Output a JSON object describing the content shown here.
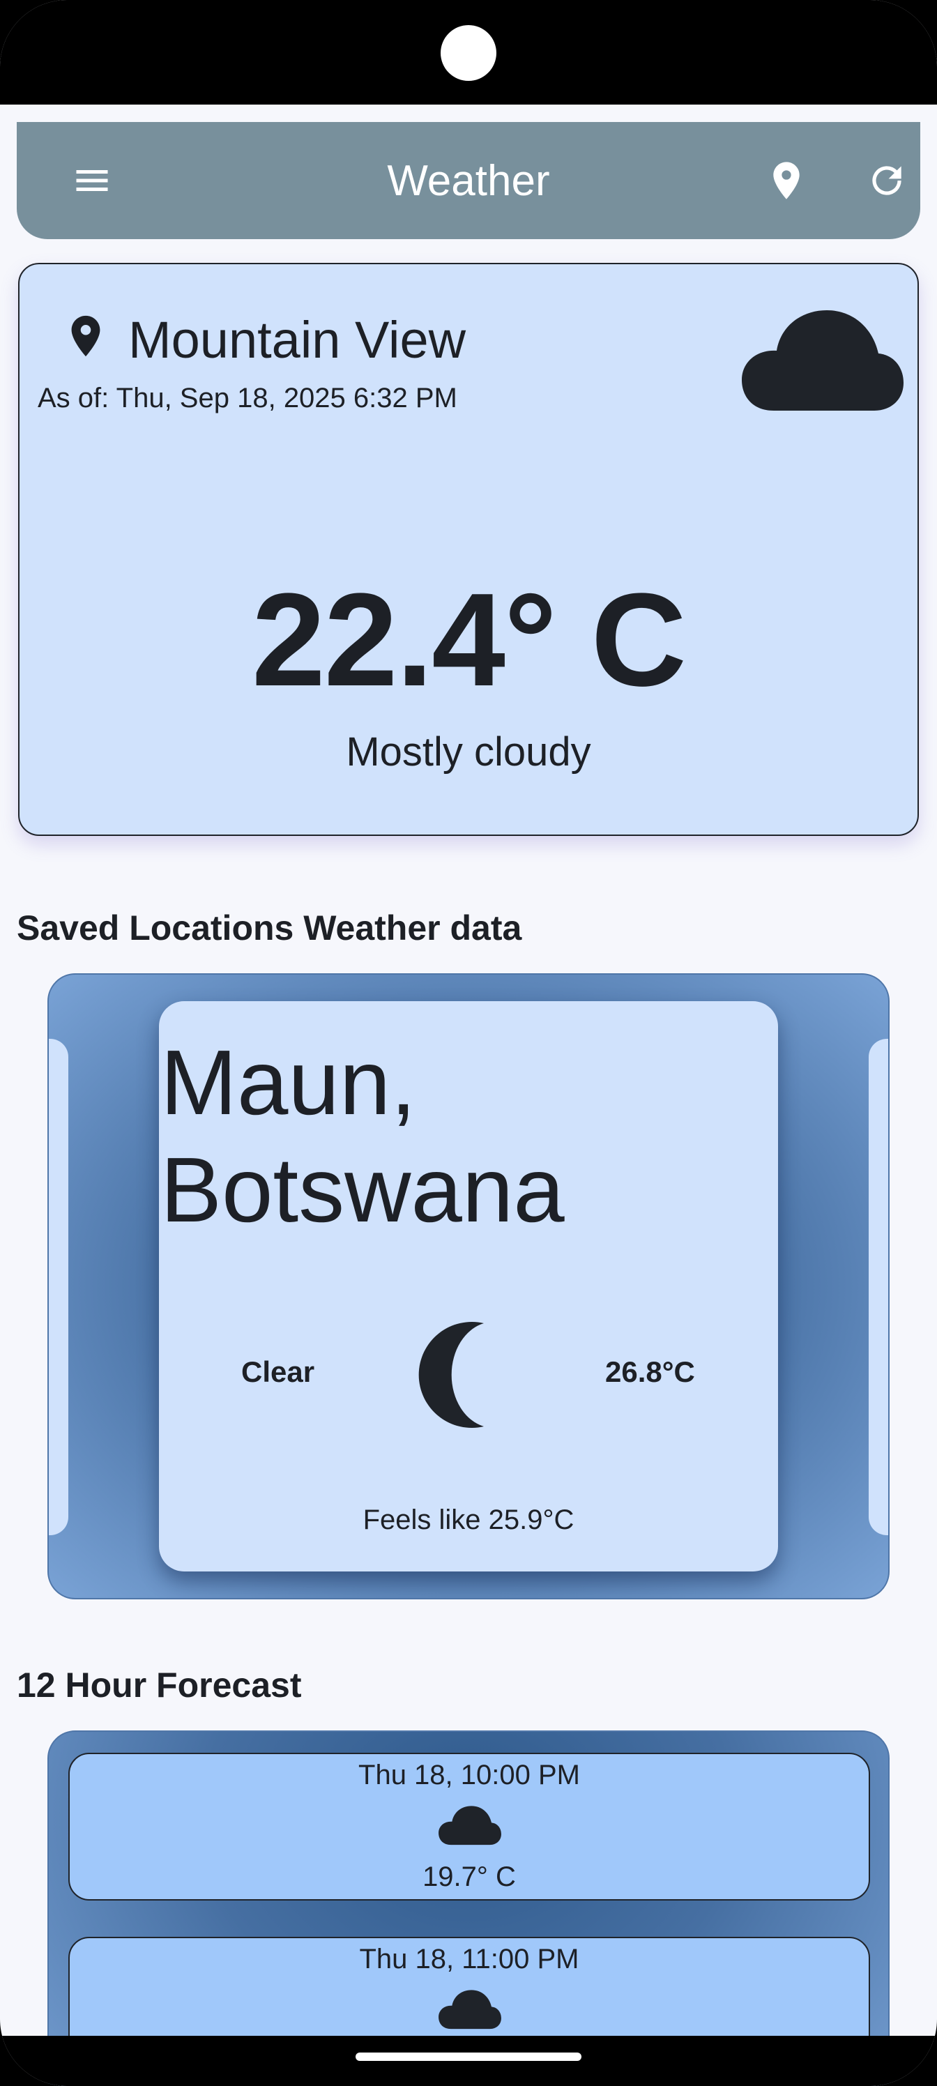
{
  "app_bar": {
    "title": "Weather",
    "menu_icon": "menu-icon",
    "location_icon": "location-pin-icon",
    "refresh_icon": "refresh-icon",
    "background": "#78909c"
  },
  "current": {
    "location": "Mountain View",
    "as_of": "As of: Thu, Sep 18, 2025 6:32 PM",
    "temperature": "22.4° C",
    "condition": "Mostly cloudy",
    "icon": "cloud-icon",
    "card_color": "#d0e2fc"
  },
  "saved_section": {
    "title": "Saved Locations Weather data",
    "cards": [
      {
        "city": "Maun, Botswana",
        "condition": "Clear",
        "icon": "moon-icon",
        "temperature": "26.8°C",
        "feels_like": "Feels like 25.9°C"
      }
    ]
  },
  "forecast_section": {
    "title": "12 Hour Forecast",
    "items": [
      {
        "time": "Thu 18, 10:00 PM",
        "icon": "cloud-icon",
        "temperature": "19.7° C"
      },
      {
        "time": "Thu 18, 11:00 PM",
        "icon": "cloud-icon",
        "temperature": ""
      }
    ],
    "item_color": "#a0c8fa"
  }
}
